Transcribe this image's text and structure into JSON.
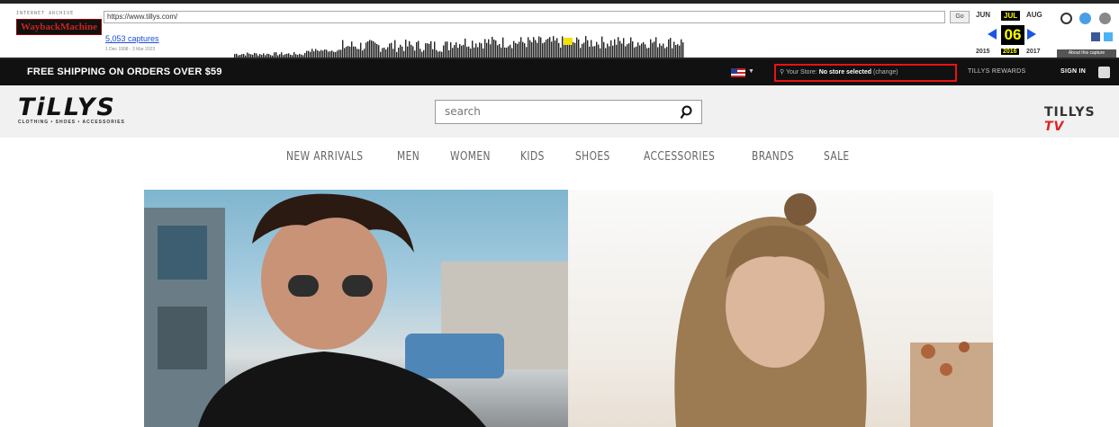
{
  "wayback": {
    "label_ia": "INTERNET ARCHIVE",
    "label_wm": "WaybackMachine",
    "url": "https://www.tillys.com/",
    "go": "Go",
    "captures": "5,053 captures",
    "range": "1 Dec 1998 - 3 Mar 2023",
    "months": [
      "JUN",
      "JUL",
      "AUG"
    ],
    "day": "06",
    "years": [
      "2015",
      "2016",
      "2017"
    ],
    "about": "About this capture"
  },
  "promo": {
    "shipping": "FREE SHIPPING ON ORDERS OVER $59",
    "store_label": "Your Store:",
    "store_value": "No store selected",
    "store_change": "(change)",
    "rewards": "TILLYS REWARDS",
    "signin": "SIGN IN"
  },
  "header": {
    "logo": "TiLLYS",
    "logo_tag": "CLOTHING • SHOES • ACCESSORIES",
    "search_placeholder": "search",
    "tv_brand": "TILLYS",
    "tv_mark": "TV"
  },
  "nav": [
    "NEW ARRIVALS",
    "MEN",
    "WOMEN",
    "KIDS",
    "SHOES",
    "ACCESSORIES",
    "BRANDS",
    "SALE"
  ],
  "colors": {
    "promo_bg": "#111111",
    "store_highlight": "#ee1111",
    "wayback_arrow": "#1a56e6",
    "header_bg": "#f1f1f1"
  }
}
